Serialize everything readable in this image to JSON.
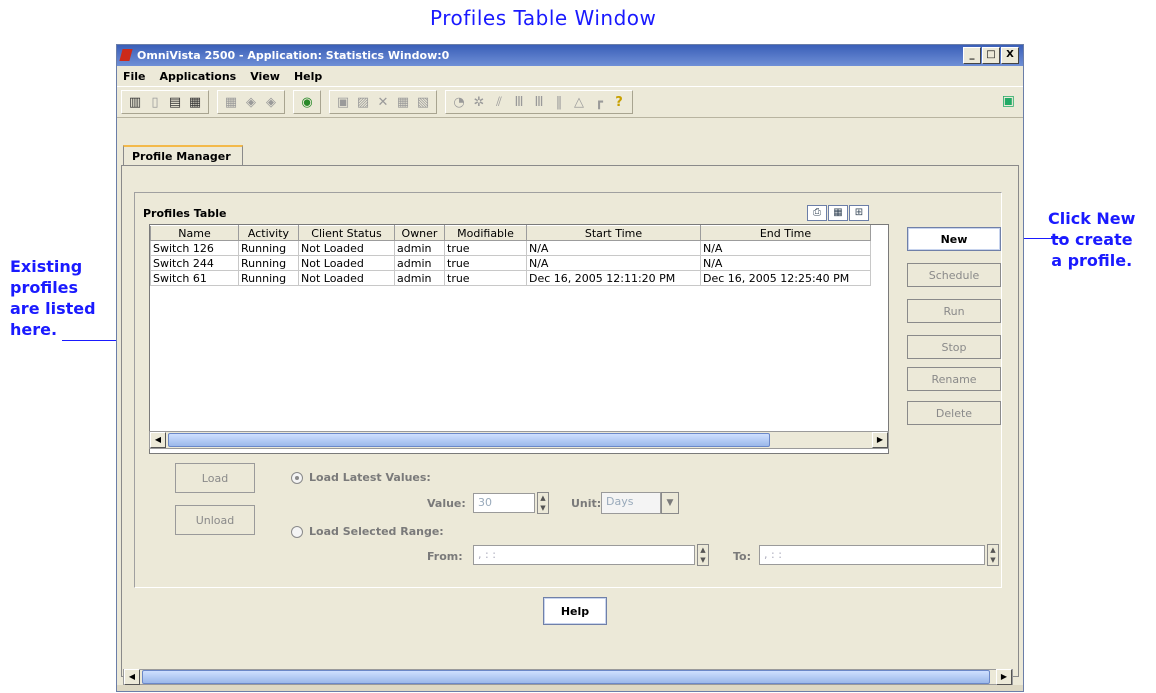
{
  "annotations": {
    "heading": "Profiles Table Window",
    "left_note": [
      "Existing",
      "profiles",
      "are listed",
      "here."
    ],
    "right_note": [
      "Click New",
      "to create",
      "a profile."
    ]
  },
  "window": {
    "title": "OmniVista 2500 -  Application: Statistics  Window:0",
    "controls": [
      "_",
      "□",
      "X"
    ]
  },
  "menu": [
    "File",
    "Applications",
    "View",
    "Help"
  ],
  "tab": {
    "label": "Profile Manager"
  },
  "profiles_table": {
    "label": "Profiles Table",
    "columns": [
      "Name",
      "Activity",
      "Client Status",
      "Owner",
      "Modifiable",
      "Start Time",
      "End Time"
    ],
    "rows": [
      [
        "Switch 126",
        "Running",
        "Not Loaded",
        "admin",
        "true",
        "N/A",
        "N/A"
      ],
      [
        "Switch 244",
        "Running",
        "Not Loaded",
        "admin",
        "true",
        "N/A",
        "N/A"
      ],
      [
        "Switch 61",
        "Running",
        "Not Loaded",
        "admin",
        "true",
        "Dec 16, 2005 12:11:20 PM",
        "Dec 16, 2005 12:25:40 PM"
      ]
    ]
  },
  "side_buttons": {
    "new": "New",
    "schedule": "Schedule",
    "run": "Run",
    "stop": "Stop",
    "rename": "Rename",
    "delete": "Delete"
  },
  "load_panel": {
    "load": "Load",
    "unload": "Unload",
    "load_latest": "Load Latest Values:",
    "value_label": "Value:",
    "value": "30",
    "unit_label": "Unit:",
    "unit": "Days",
    "load_range": "Load Selected Range:",
    "from_label": "From:",
    "from_value": ",  : :",
    "to_label": "To:",
    "to_value": ",  : :"
  },
  "help_button": "Help"
}
